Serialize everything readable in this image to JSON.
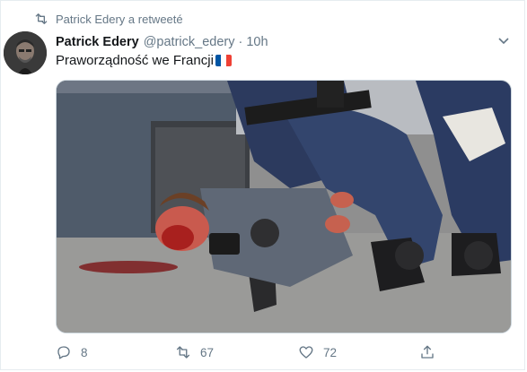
{
  "retweet": {
    "icon": "retweet-icon",
    "label": "Patrick Edery a retweeté"
  },
  "tweet": {
    "author_name": "Patrick Edery",
    "author_handle": "@patrick_edery",
    "separator": "·",
    "time": "10h",
    "text": "Praworządność we Francji",
    "flag_emoji": "france-flag",
    "media_description": "photo"
  },
  "actions": {
    "reply_count": "8",
    "retweet_count": "67",
    "like_count": "72"
  },
  "colors": {
    "muted": "#657786",
    "text": "#14171a",
    "border": "#e6ecf0",
    "flag_blue": "#0055a4",
    "flag_white": "#ffffff",
    "flag_red": "#ef4135"
  }
}
